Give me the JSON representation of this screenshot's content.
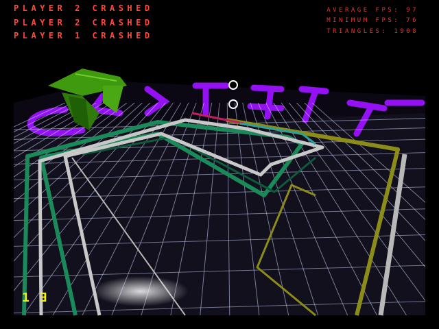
{
  "hud": {
    "messages": [
      "PLAYER 2 CRASHED",
      "PLAYER 2 CRASHED",
      "PLAYER 1 CRASHED"
    ],
    "stats": [
      {
        "label": "AVERAGE FPS:",
        "value": "97"
      },
      {
        "label": "MINIMUM FPS:",
        "value": "76"
      },
      {
        "label": "TRIANGLES:",
        "value": "1908"
      }
    ],
    "speed": "1 ∃"
  },
  "colors": {
    "floor": "#12101c",
    "grid": "#cfd8ff",
    "wall_purple": "#9b12ff",
    "trail_green": "#1a8a5a",
    "trail_white": "#c8c8c8",
    "trail_yellow": "#8c8c18",
    "trail_pink": "#c02060",
    "cycle_green": "#3f9a10"
  },
  "icons": [
    "light-cycle-green"
  ]
}
